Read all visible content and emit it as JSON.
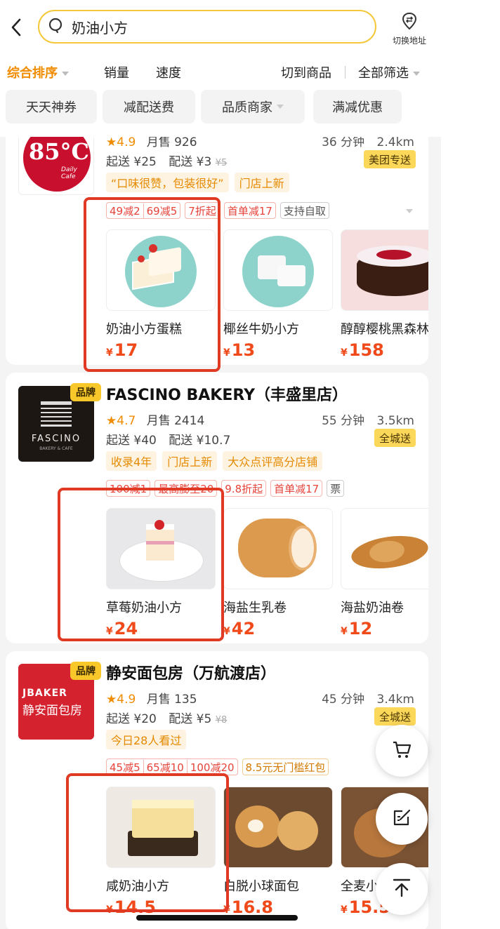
{
  "search": {
    "query": "奶油小方"
  },
  "header": {
    "switch_address": "切换地址"
  },
  "sort": {
    "comprehensive": "综合排序",
    "sales": "销量",
    "speed": "速度",
    "switch_goods": "切到商品",
    "all_filter": "全部筛选"
  },
  "chips": [
    "天天神券",
    "减配送费",
    "品质商家",
    "满减优惠"
  ],
  "stores": [
    {
      "logo_text": "85°C",
      "logo_sub": "Daily Cafe",
      "rating": "4.9",
      "monthly_sales": "月售 926",
      "time": "36 分钟",
      "distance": "2.4km",
      "min_order": "起送 ¥25",
      "delivery_fee": "配送 ¥3",
      "original_fee": "¥5",
      "delivery_tag": "美团专送",
      "features": [
        "“口味很赞，包装很好”",
        "门店上新"
      ],
      "promos": [
        "49减2",
        "69减5",
        "7折起",
        "首单减17",
        "支持自取"
      ],
      "products": [
        {
          "name": "奶油小方蛋糕",
          "price": "17"
        },
        {
          "name": "椰丝牛奶小方",
          "price": "13"
        },
        {
          "name": "醇醇樱桃黑森林",
          "price": "158"
        }
      ]
    },
    {
      "badge": "品牌",
      "logo_text": "FASCINO",
      "logo_sub": "BAKERY & CAFE",
      "name": "FASCINO BAKERY（丰盛里店）",
      "rating": "4.7",
      "monthly_sales": "月售 2414",
      "time": "55 分钟",
      "distance": "3.5km",
      "min_order": "起送 ¥40",
      "delivery_fee": "配送 ¥10.7",
      "delivery_tag": "全城送",
      "features": [
        "收录4年",
        "门店上新",
        "大众点评高分店铺"
      ],
      "promos": [
        "100减1",
        "最高膨至20",
        "9.8折起",
        "首单减17",
        "票"
      ],
      "products": [
        {
          "name": "草莓奶油小方",
          "price": "24"
        },
        {
          "name": "海盐生乳卷",
          "price": "42"
        },
        {
          "name": "海盐奶油卷",
          "price": "12"
        }
      ]
    },
    {
      "badge": "品牌",
      "logo_text": "JBAKER",
      "logo_sub": "静安面包房",
      "name": "静安面包房（万航渡店）",
      "rating": "4.9",
      "monthly_sales": "月售 135",
      "time": "45 分钟",
      "distance": "3.4km",
      "min_order": "起送 ¥20",
      "delivery_fee": "配送 ¥5",
      "original_fee": "¥8",
      "delivery_tag": "全城送",
      "features": [
        "今日28人看过"
      ],
      "promos": [
        "45减5",
        "65减10",
        "100减20",
        "8.5元无门槛红包"
      ],
      "products": [
        {
          "name": "咸奶油小方",
          "price": "14.5"
        },
        {
          "name": "白脱小球面包",
          "price": "16.8"
        },
        {
          "name": "全麦小",
          "price": "15.5"
        }
      ]
    }
  ],
  "currency": "¥"
}
